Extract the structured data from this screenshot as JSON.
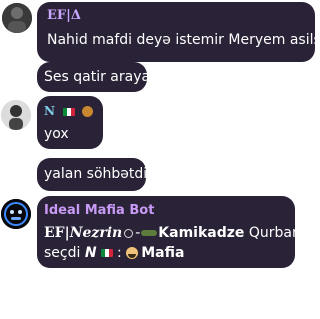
{
  "messages": [
    {
      "sender": "EF|Δ",
      "text": "Nahid mafdi deyə istemir Meryem asilsin"
    },
    {
      "text": "Ses qatir araya"
    },
    {
      "sender": "N",
      "text": "yox"
    },
    {
      "text": "yalan söhbətdi"
    },
    {
      "sender": "Ideal Mafia Bot",
      "line1_prefix": "EF|",
      "line1_name": "Nezrin",
      "line1_sep": "-",
      "line1_role": "Kamikadze",
      "line1_suffix": " Qurbanı",
      "line2_prefix": "seçdi ",
      "line2_name": "N",
      "line2_sep": " : ",
      "line2_role": "Mafia"
    }
  ],
  "colors": {
    "bubble": "#2a2236",
    "sender": "#c9a7ff",
    "bot_sender": "#c79bf5",
    "background": "#ffffff"
  },
  "icons": [
    "mexico-flag-icon",
    "ball-icon",
    "ring-icon",
    "dynamite-icon",
    "spy-face-icon",
    "avatar-robot-icon"
  ]
}
